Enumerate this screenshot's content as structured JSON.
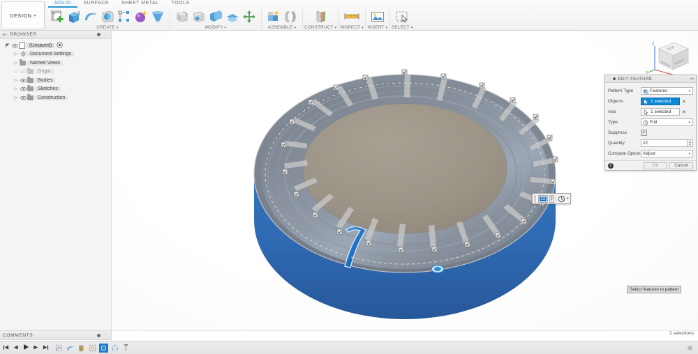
{
  "app": {
    "workspace_label": "DESIGN",
    "tabs": [
      {
        "label": "SOLID",
        "active": true
      },
      {
        "label": "SURFACE",
        "active": false
      },
      {
        "label": "SHEET METAL",
        "active": false
      },
      {
        "label": "TOOLS",
        "active": false
      }
    ],
    "panels": [
      {
        "label": "CREATE",
        "caret": "▾"
      },
      {
        "label": "MODIFY",
        "caret": "▾"
      },
      {
        "label": "ASSEMBLE",
        "caret": "▾"
      },
      {
        "label": "CONSTRUCT",
        "caret": "▾"
      },
      {
        "label": "INSPECT",
        "caret": "▾"
      },
      {
        "label": "INSERT",
        "caret": "▾"
      },
      {
        "label": "SELECT",
        "caret": "▾"
      }
    ]
  },
  "browser": {
    "header_title": "BROWSER",
    "items": [
      {
        "label": "(Unsaved)",
        "level": 0,
        "type": "document",
        "visible": true,
        "expanded": true
      },
      {
        "label": "Document Settings",
        "level": 1,
        "type": "settings",
        "visible": false,
        "expanded": false
      },
      {
        "label": "Named Views",
        "level": 1,
        "type": "folder",
        "visible": false,
        "expanded": false
      },
      {
        "label": "Origin",
        "level": 1,
        "type": "folder",
        "visible": false,
        "expanded": false,
        "dimmed": true
      },
      {
        "label": "Bodies",
        "level": 1,
        "type": "folder",
        "visible": true,
        "expanded": false
      },
      {
        "label": "Sketches",
        "level": 1,
        "type": "folder",
        "visible": true,
        "expanded": false
      },
      {
        "label": "Construction",
        "level": 1,
        "type": "folder",
        "visible": true,
        "expanded": false
      }
    ]
  },
  "edit_feature": {
    "title": "EDIT FEATURE",
    "rows": {
      "pattern_type_label": "Pattern Type",
      "pattern_type_value": "Features",
      "objects_label": "Objects",
      "objects_value": "1 selected",
      "axis_label": "Axis",
      "axis_value": "1 selected",
      "type_label": "Type",
      "type_value": "Full",
      "suppress_label": "Suppress",
      "suppress_checked": true,
      "quantity_label": "Quantity",
      "quantity_value": "22",
      "compute_option_label": "Compute Option",
      "compute_option_value": "Adjust"
    },
    "ok_label": "OK",
    "cancel_label": "Cancel",
    "clear_mark": "✕",
    "accent_color": "#0e87d6"
  },
  "canvas": {
    "tooltip_text": "Select features to pattern",
    "widget_quantity": "22"
  },
  "viewcube": {
    "top_face_label": "TOP",
    "front_face_label": "FRONT",
    "right_face_label": "RIGHT",
    "axis_x_label": "X",
    "axis_y_label": "Y",
    "axis_z_label": "Z"
  },
  "navbar": {
    "items": [
      {
        "name": "orbit-icon",
        "has_caret": true
      },
      {
        "name": "pan-icon",
        "has_caret": false
      },
      {
        "name": "look-at-icon",
        "has_caret": false
      },
      {
        "name": "zoom-icon",
        "has_caret": false
      },
      {
        "name": "zoom-window-icon",
        "has_caret": true
      },
      {
        "name": "display-settings-icon",
        "has_caret": true
      },
      {
        "name": "grid-snap-icon",
        "has_caret": true
      },
      {
        "name": "viewports-icon",
        "has_caret": true
      }
    ]
  },
  "comments": {
    "header_title": "COMMENTS"
  },
  "status": {
    "selections_text": "2 selections"
  },
  "timeline": {
    "nav_buttons": [
      "go-to-start",
      "step-back",
      "play",
      "step-forward",
      "go-to-end"
    ],
    "features": [
      {
        "name": "sketch-feature",
        "selected": false
      },
      {
        "name": "revolve-feature",
        "selected": false
      },
      {
        "name": "extrude-feature",
        "selected": false
      },
      {
        "name": "sketch2-feature",
        "selected": false
      },
      {
        "name": "cut-feature",
        "selected": true
      },
      {
        "name": "circular-pattern-feature",
        "selected": false
      }
    ]
  },
  "model": {
    "body_color_blue": "#2f6ab3",
    "body_color_metal": "#9b9585",
    "highlight_color": "#1f6fc4",
    "glass_color": "#6c7e99",
    "slot_count": 22
  }
}
